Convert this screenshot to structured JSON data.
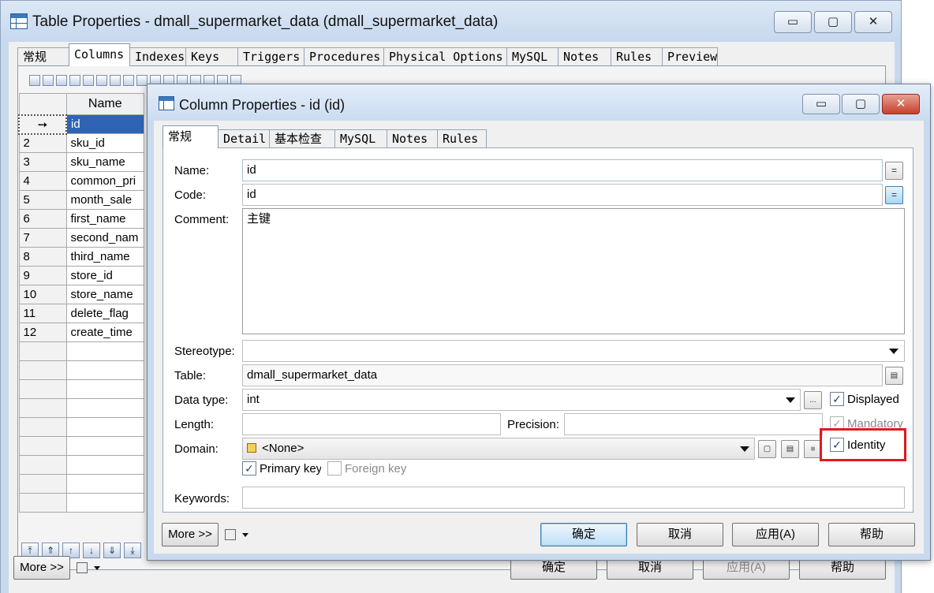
{
  "outer": {
    "title": "Table Properties - dmall_supermarket_data (dmall_supermarket_data)",
    "window_buttons": {
      "minimize": "▭",
      "maximize": "▢",
      "close": "✕"
    },
    "tabs": [
      "常规",
      "Columns",
      "Indexes",
      "Keys",
      "Triggers",
      "Procedures",
      "Physical Options",
      "MySQL",
      "Notes",
      "Rules",
      "Preview"
    ],
    "grid": {
      "header_name": "Name",
      "rows": [
        {
          "num": "➙",
          "name": "id"
        },
        {
          "num": "2",
          "name": "sku_id"
        },
        {
          "num": "3",
          "name": "sku_name"
        },
        {
          "num": "4",
          "name": "common_pri"
        },
        {
          "num": "5",
          "name": "month_sale"
        },
        {
          "num": "6",
          "name": "first_name"
        },
        {
          "num": "7",
          "name": "second_nam"
        },
        {
          "num": "8",
          "name": "third_name"
        },
        {
          "num": "9",
          "name": "store_id"
        },
        {
          "num": "10",
          "name": "store_name"
        },
        {
          "num": "11",
          "name": "delete_flag"
        },
        {
          "num": "12",
          "name": "create_time"
        }
      ]
    },
    "nav_arrows": [
      "⤒",
      "⇑",
      "↑",
      "↓",
      "⇓",
      "⤓"
    ],
    "more_label": "More >>",
    "buttons": {
      "ok": "确定",
      "cancel": "取消",
      "apply": "应用(A)",
      "help": "帮助"
    }
  },
  "dialog": {
    "title": "Column Properties - id (id)",
    "window_buttons": {
      "minimize": "▭",
      "maximize": "▢",
      "close": "✕"
    },
    "tabs": [
      "常规",
      "Detail",
      "基本检查",
      "MySQL",
      "Notes",
      "Rules"
    ],
    "form": {
      "name_label": "Name:",
      "name_value": "id",
      "code_label": "Code:",
      "code_value": "id",
      "comment_label": "Comment:",
      "comment_value": "主键",
      "stereotype_label": "Stereotype:",
      "stereotype_value": "",
      "table_label": "Table:",
      "table_value": "dmall_supermarket_data",
      "datatype_label": "Data type:",
      "datatype_value": "int",
      "length_label": "Length:",
      "length_value": "",
      "precision_label": "Precision:",
      "precision_value": "",
      "domain_label": "Domain:",
      "domain_value": "<None>",
      "keywords_label": "Keywords:",
      "keywords_value": "",
      "equals_glyph": "=",
      "ellipsis_glyph": "...",
      "check_glyph": "✓"
    },
    "checks": {
      "displayed": {
        "label": "Displayed",
        "checked": true,
        "enabled": true
      },
      "mandatory": {
        "label": "Mandatory",
        "checked": true,
        "enabled": false
      },
      "identity": {
        "label": "Identity",
        "checked": true,
        "enabled": true,
        "highlight_color": "#e0191f"
      },
      "primary_key": {
        "label": "Primary key",
        "checked": true,
        "enabled": true
      },
      "foreign_key": {
        "label": "Foreign key",
        "checked": false,
        "enabled": false
      }
    },
    "more_label": "More >>",
    "buttons": {
      "ok": "确定",
      "cancel": "取消",
      "apply": "应用(A)",
      "help": "帮助"
    }
  }
}
